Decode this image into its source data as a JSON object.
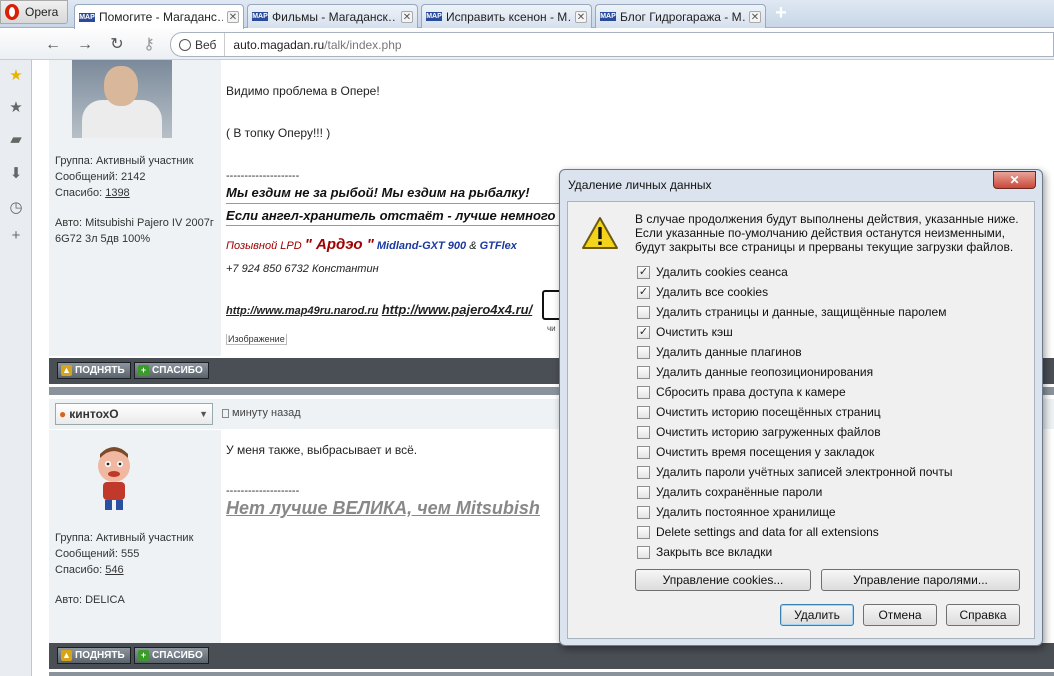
{
  "browser": {
    "menu_label": "Opera",
    "tabs": [
      {
        "label": "Помогите - Магаданс…",
        "favicon": "MAP",
        "active": true
      },
      {
        "label": "Фильмы - Магаданск…",
        "favicon": "MAP",
        "active": false
      },
      {
        "label": "Исправить ксенон - М…",
        "favicon": "MAP",
        "active": false
      },
      {
        "label": "Блог Гидрогаража - М…",
        "favicon": "MAP",
        "active": false
      }
    ],
    "new_tab": "+",
    "address_badge": "Веб",
    "url_host": "auto.magadan.ru",
    "url_path": "/talk/index.php"
  },
  "post1": {
    "lines": [
      "Видимо проблема в Опере!",
      "( В топку Оперу!!! )"
    ],
    "user": {
      "group": "Группа: Активный участник",
      "messages": "Сообщений: 2142",
      "thanks_label": "Спасибо:",
      "thanks_count": "1398",
      "auto": "Авто: Mitsubishi Pajero IV 2007г 6G72 3л 5дв 100%"
    },
    "sig_dashes": "--------------------",
    "sig_line1": "Мы ездим не за рыбой! Мы ездим на рыбалку!",
    "sig_line2": "Если ангел-хранитель отстаёт - лучше немного",
    "callsign_prefix": "Позывной LPD",
    "callsign_name": "\" Ардэо \"",
    "radio1": "Midland-GXT 900",
    "radio_amp": "&",
    "radio2": "GTFlex",
    "phone": "+7 924 850 6732 Константин",
    "link1": "http://www.map49ru.narod.ru",
    "link2": "http://www.pajero4x4.ru/",
    "image_caption": "Изображение",
    "partial_caption": "чи"
  },
  "buttons": {
    "up": "ПОДНЯТЬ",
    "thanks": "СПАСИБО"
  },
  "post2": {
    "username": "кинтохО",
    "time": "минуту назад",
    "text": "У меня также, выбрасывает и всё.",
    "sig_dashes": "--------------------",
    "sig": "Нет лучше ВЕЛИКА, чем Mitsubish",
    "user": {
      "group": "Группа: Активный участник",
      "messages": "Сообщений: 555",
      "thanks_label": "Спасибо:",
      "thanks_count": "546",
      "auto": "Авто: DELICA"
    }
  },
  "dialog": {
    "title": "Удаление личных данных",
    "close": "✕",
    "message": "В случае продолжения будут выполнены действия, указанные ниже. Если указанные по-умолчанию действия останутся неизменными, будут закрыты все страницы и прерваны текущие загрузки файлов.",
    "options": [
      {
        "label": "Удалить cookies сеанса",
        "checked": true
      },
      {
        "label": "Удалить все cookies",
        "checked": true
      },
      {
        "label": "Удалить страницы и данные, защищённые паролем",
        "checked": false
      },
      {
        "label": "Очистить кэш",
        "checked": true
      },
      {
        "label": "Удалить данные плагинов",
        "checked": false
      },
      {
        "label": "Удалить данные геопозиционирования",
        "checked": false
      },
      {
        "label": "Сбросить права доступа к камере",
        "checked": false
      },
      {
        "label": "Очистить историю посещённых страниц",
        "checked": false
      },
      {
        "label": "Очистить историю загруженных файлов",
        "checked": false
      },
      {
        "label": "Очистить время посещения у закладок",
        "checked": false
      },
      {
        "label": "Удалить пароли учётных записей электронной почты",
        "checked": false
      },
      {
        "label": "Удалить сохранённые пароли",
        "checked": false
      },
      {
        "label": "Удалить постоянное хранилище",
        "checked": false
      },
      {
        "label": "Delete settings and data for all extensions",
        "checked": false
      },
      {
        "label": "Закрыть все вкладки",
        "checked": false
      }
    ],
    "manage_cookies": "Управление cookies...",
    "manage_passwords": "Управление паролями...",
    "delete": "Удалить",
    "cancel": "Отмена",
    "help": "Справка"
  }
}
